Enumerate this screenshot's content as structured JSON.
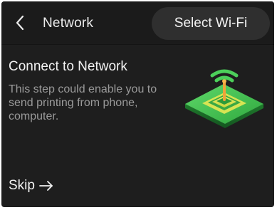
{
  "header": {
    "back_icon": "chevron-left-icon",
    "title": "Network",
    "action_label": "Select Wi-Fi"
  },
  "content": {
    "title": "Connect to Network",
    "description": "This step could enable you to send printing from phone, computer.",
    "illustration": "wifi-router-icon"
  },
  "footer": {
    "skip_label": "Skip",
    "skip_icon": "arrow-right-icon"
  },
  "colors": {
    "background": "#1e1e1e",
    "button_bg": "#2f2f2f",
    "accent_green": "#3fbf4f",
    "text_primary": "#f2f2f2",
    "text_secondary": "#9a9a9a"
  }
}
